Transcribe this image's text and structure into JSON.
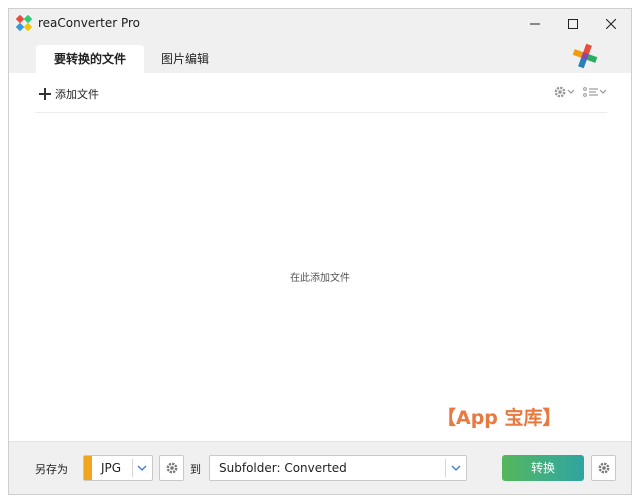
{
  "app": {
    "title": "reaConverter Pro"
  },
  "tabs": [
    {
      "label": "要转换的文件",
      "active": true
    },
    {
      "label": "图片编辑",
      "active": false
    }
  ],
  "toolbar": {
    "add_files_label": "添加文件"
  },
  "main": {
    "drop_hint": "在此添加文件"
  },
  "watermark": "【App 宝库】",
  "bottom": {
    "save_as_label": "另存为",
    "format_value": "JPG",
    "to_label": "到",
    "destination_value": "Subfolder: Converted",
    "convert_label": "转换"
  },
  "colors": {
    "format_strip": "#f2a51f",
    "convert_start": "#56b65a",
    "convert_end": "#2fa4a0",
    "chrome_bg": "#f0f0f0"
  },
  "icons": [
    "app-logo-icon",
    "minimize-icon",
    "maximize-icon",
    "close-icon",
    "brand-logo-icon",
    "plus-icon",
    "gear-icon",
    "list-view-icon",
    "chevron-down-icon"
  ]
}
